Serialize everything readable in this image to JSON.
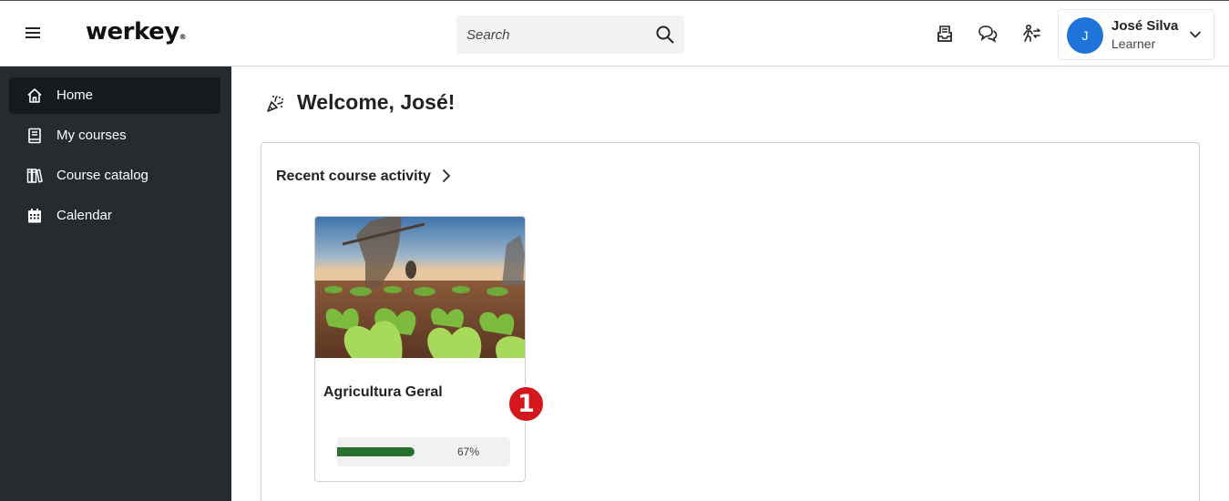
{
  "header": {
    "logo_text": "werkey",
    "logo_mark": "®",
    "search": {
      "placeholder": "Search",
      "value": ""
    },
    "icons": [
      "menu-icon",
      "inbox-icon",
      "chat-icon",
      "user-switch-icon",
      "search-icon",
      "chevron-down-icon"
    ],
    "user": {
      "initial": "J",
      "name": "José Silva",
      "role": "Learner"
    },
    "accent_color": "#1f74d9"
  },
  "sidebar": {
    "background": "#262b30",
    "items": [
      {
        "label": "Home",
        "icon": "home-icon",
        "active": true
      },
      {
        "label": "My courses",
        "icon": "book-icon",
        "active": false
      },
      {
        "label": "Course catalog",
        "icon": "library-icon",
        "active": false
      },
      {
        "label": "Calendar",
        "icon": "calendar-icon",
        "active": false
      }
    ]
  },
  "main": {
    "welcome": "Welcome, José!",
    "welcome_icon": "party-popper-icon",
    "recent": {
      "title": "Recent course activity",
      "courses": [
        {
          "title": "Agricultura Geral",
          "progress": 67,
          "progress_label": "67%",
          "progress_color": "#27702f"
        }
      ]
    },
    "annotation": {
      "number": "1",
      "color": "#d5161d"
    }
  }
}
